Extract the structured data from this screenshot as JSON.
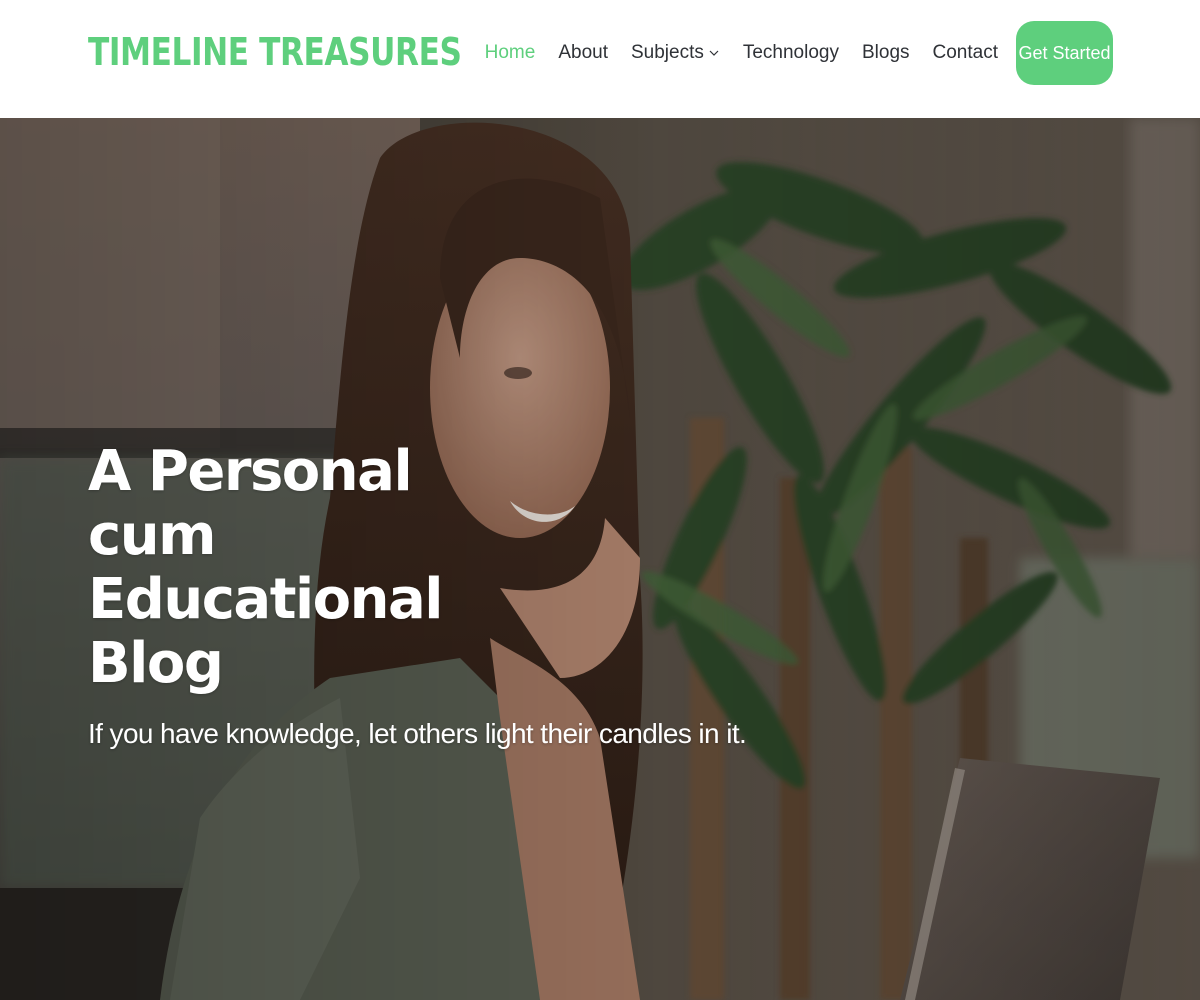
{
  "site": {
    "logo": "TIMELINE TREASURES",
    "accent_color": "#5ecf7d"
  },
  "nav": {
    "items": [
      {
        "label": "Home",
        "active": true
      },
      {
        "label": "About",
        "active": false
      },
      {
        "label": "Subjects",
        "active": false,
        "has_dropdown": true,
        "icon": "chevron-down-icon"
      },
      {
        "label": "Technology",
        "active": false
      },
      {
        "label": "Blogs",
        "active": false
      },
      {
        "label": "Contact",
        "active": false
      }
    ],
    "cta_label": "Get Started"
  },
  "hero": {
    "title": "A Personal cum Educational Blog",
    "subtitle": "If you have knowledge, let others light their candles in it."
  }
}
